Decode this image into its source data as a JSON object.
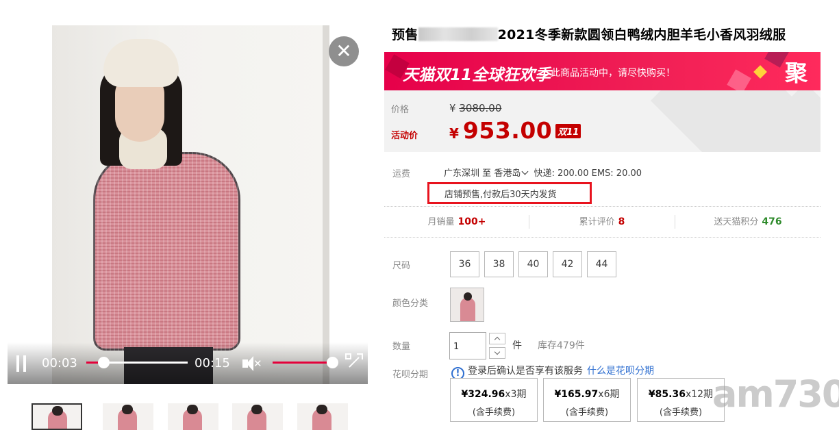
{
  "video": {
    "current_time": "00:03",
    "duration": "00:15",
    "progress_fraction": 0.17,
    "volume_fraction": 1.0
  },
  "product": {
    "title_prefix": "预售",
    "title_suffix": "2021冬季新款圆领白鸭绒内胆羊毛小香风羽绒服"
  },
  "banner": {
    "logo_text": "天猫双11全球狂欢季",
    "message": "此商品活动中，请尽快购买！",
    "badge": "聚"
  },
  "price": {
    "label": "价格",
    "currency": "¥",
    "original": "3080.00",
    "promo_label": "活动价",
    "promo_value": "953.00",
    "promo_tag": "双11"
  },
  "shipping": {
    "label": "运费",
    "route_from": "广东深圳",
    "route_to_word": "至",
    "route_to": "香港岛",
    "fees": "快递: 200.00 EMS: 20.00",
    "presale_note": "店铺预售,付款后30天内发货"
  },
  "stats": [
    {
      "label": "月销量",
      "value": "100+",
      "color": "#c40000"
    },
    {
      "label": "累计评价",
      "value": "8",
      "color": "#c40000"
    },
    {
      "label": "送天猫积分",
      "value": "476",
      "color": "#2f8b2c"
    }
  ],
  "options": {
    "size_label": "尺码",
    "sizes": [
      "36",
      "38",
      "40",
      "42",
      "44"
    ],
    "color_label": "颜色分类",
    "qty_label": "数量",
    "qty_value": "1",
    "qty_unit": "件",
    "stock": "库存479件"
  },
  "installment": {
    "label": "花呗分期",
    "info_icon": "info-icon",
    "info_text": "登录后确认是否享有该服务",
    "info_link": "什么是花呗分期",
    "plans": [
      {
        "amount": "¥324.96",
        "period": "x3期",
        "fee": "(含手续费)"
      },
      {
        "amount": "¥165.97",
        "period": "x6期",
        "fee": "(含手续费)"
      },
      {
        "amount": "¥85.36",
        "period": "x12期",
        "fee": "(含手续费)"
      }
    ]
  },
  "watermark": "am730",
  "colors": {
    "accent_red": "#c40000",
    "banner_red": "#e6004a",
    "highlight_border": "#e8131e",
    "link_blue": "#2f6fd0",
    "points_green": "#2f8b2c"
  }
}
